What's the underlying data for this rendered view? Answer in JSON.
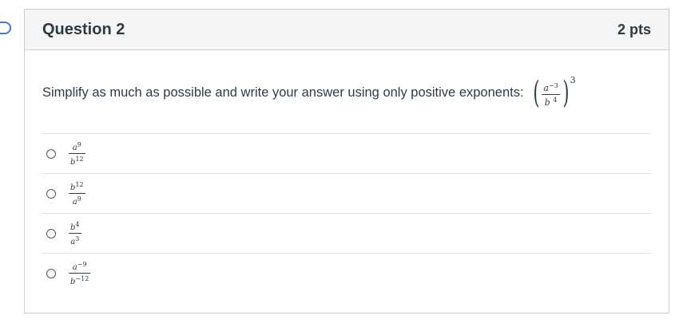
{
  "question": {
    "title": "Question 2",
    "points": "2 pts",
    "prompt": "Simplify as much as possible and write your answer using only positive exponents:",
    "expression": {
      "num_base": "a",
      "num_exp": "−3",
      "den_base": "b",
      "den_exp": "4",
      "outer_exp": "3"
    }
  },
  "answers": [
    {
      "num_base": "a",
      "num_exp": "9",
      "den_base": "b",
      "den_exp": "12"
    },
    {
      "num_base": "b",
      "num_exp": "12",
      "den_base": "a",
      "den_exp": "9"
    },
    {
      "num_base": "b",
      "num_exp": "4",
      "den_base": "a",
      "den_exp": "3"
    },
    {
      "num_base": "a",
      "num_exp": "−9",
      "den_base": "b",
      "den_exp": "−12"
    }
  ]
}
